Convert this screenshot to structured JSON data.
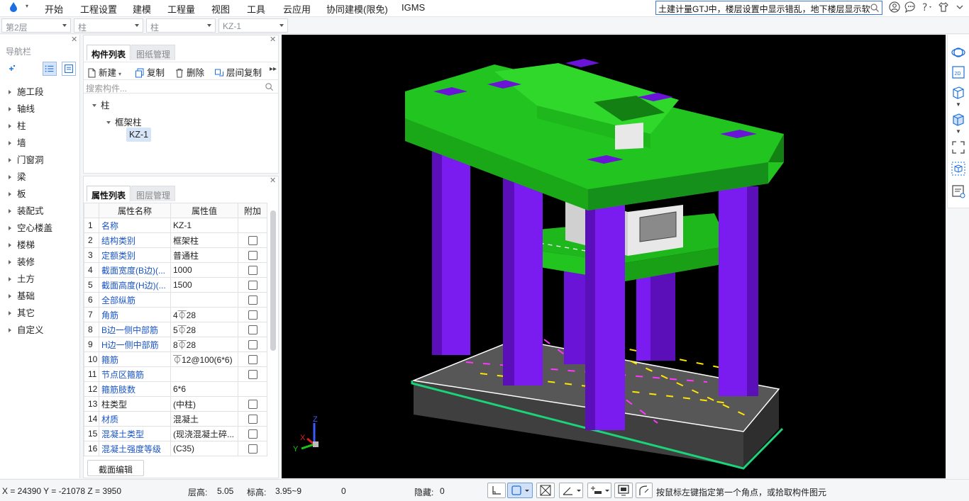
{
  "menubar": {
    "items": [
      "开始",
      "工程设置",
      "建模",
      "工程量",
      "视图",
      "工具",
      "云应用",
      "协同建模(限免)",
      "IGMS"
    ],
    "search_text": "土建计量GTJ中，楼层设置中显示错乱，地下楼层显示软"
  },
  "selectors": [
    "第2层",
    "柱",
    "柱",
    "KZ-1"
  ],
  "nav": {
    "title": "导航栏",
    "items": [
      "施工段",
      "轴线",
      "柱",
      "墙",
      "门窗洞",
      "梁",
      "板",
      "装配式",
      "空心楼盖",
      "楼梯",
      "装修",
      "土方",
      "基础",
      "其它",
      "自定义"
    ]
  },
  "component_panel": {
    "tabs": [
      "构件列表",
      "图纸管理"
    ],
    "toolbar": [
      "新建",
      "复制",
      "删除",
      "层间复制"
    ],
    "search_placeholder": "搜索构件...",
    "tree": {
      "root": "柱",
      "child": "框架柱",
      "leaf": "KZ-1"
    }
  },
  "property_panel": {
    "tabs": [
      "属性列表",
      "图层管理"
    ],
    "headers": [
      "属性名称",
      "属性值",
      "附加"
    ],
    "rows": [
      {
        "n": "1",
        "name": "名称",
        "value": "KZ-1",
        "blue": true,
        "check": false
      },
      {
        "n": "2",
        "name": "结构类别",
        "value": "框架柱",
        "blue": true,
        "check": true
      },
      {
        "n": "3",
        "name": "定额类别",
        "value": "普通柱",
        "blue": true,
        "check": true
      },
      {
        "n": "4",
        "name": "截面宽度(B边)(...",
        "value": "1000",
        "blue": true,
        "check": true
      },
      {
        "n": "5",
        "name": "截面高度(H边)(...",
        "value": "1500",
        "blue": true,
        "check": true
      },
      {
        "n": "6",
        "name": "全部纵筋",
        "value": "",
        "blue": true,
        "check": true
      },
      {
        "n": "7",
        "name": "角筋",
        "value": "4⏁28",
        "blue": true,
        "check": true
      },
      {
        "n": "8",
        "name": "B边一侧中部筋",
        "value": "5⏁28",
        "blue": true,
        "check": true
      },
      {
        "n": "9",
        "name": "H边一侧中部筋",
        "value": "8⏁28",
        "blue": true,
        "check": true
      },
      {
        "n": "10",
        "name": "箍筋",
        "value": "⏁12@100(6*6)",
        "blue": true,
        "check": true
      },
      {
        "n": "11",
        "name": "节点区箍筋",
        "value": "",
        "blue": true,
        "check": true
      },
      {
        "n": "12",
        "name": "箍筋肢数",
        "value": "6*6",
        "blue": true,
        "check": false
      },
      {
        "n": "13",
        "name": "柱类型",
        "value": "(中柱)",
        "blue": false,
        "check": true
      },
      {
        "n": "14",
        "name": "材质",
        "value": "混凝土",
        "blue": true,
        "check": true
      },
      {
        "n": "15",
        "name": "混凝土类型",
        "value": "(现浇混凝土碎...",
        "blue": true,
        "check": true
      },
      {
        "n": "16",
        "name": "混凝土强度等级",
        "value": "(C35)",
        "blue": true,
        "check": true
      }
    ],
    "section_edit": "截面编辑"
  },
  "viewport": {
    "axis_labels": {
      "x": "X",
      "y": "Y",
      "z": "Z"
    },
    "colors": {
      "slab": "#22c41f",
      "column": "#7a1cf0",
      "base": "#4b4b4b",
      "edge": "#1bd47a",
      "wall": "#e8e8e8"
    }
  },
  "statusbar": {
    "coords": "X = 24390 Y = -21078 Z = 3950",
    "floor_height_label": "层高:",
    "floor_height": "5.05",
    "elevation_label": "标高:",
    "elevation": "3.95~9",
    "count": "0",
    "hidden_label": "隐藏:",
    "hidden": "0",
    "hint": "按鼠标左键指定第一个角点，或拾取构件图元"
  }
}
